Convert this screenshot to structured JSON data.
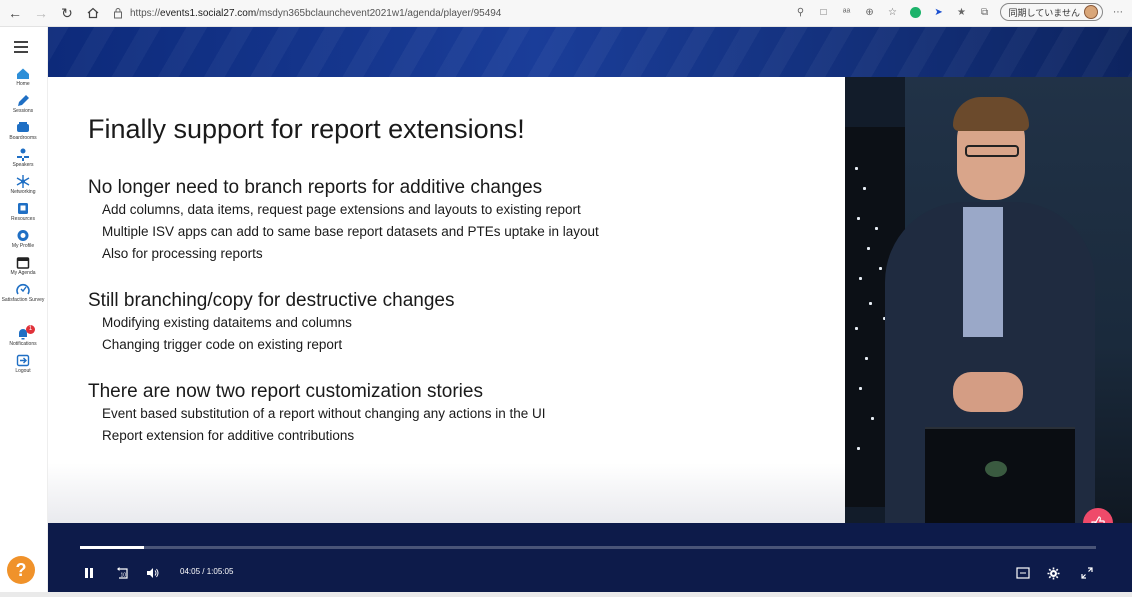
{
  "browser": {
    "url_prefix": "https://",
    "url_host": "events1.social27.com",
    "url_path": "/msdyn365bclaunchevent2021w1/agenda/player/95494",
    "profile_label": "同期していません"
  },
  "sidebar": {
    "items": [
      {
        "label": "Home",
        "icon": "home-icon"
      },
      {
        "label": "Sessions",
        "icon": "pencil-icon"
      },
      {
        "label": "Boardrooms",
        "icon": "boardroom-icon"
      },
      {
        "label": "Speakers",
        "icon": "speaker-icon"
      },
      {
        "label": "Networking",
        "icon": "networking-icon"
      },
      {
        "label": "Resources",
        "icon": "resources-icon"
      },
      {
        "label": "My Profile",
        "icon": "profile-icon"
      },
      {
        "label": "My Agenda",
        "icon": "calendar-icon"
      },
      {
        "label": "Satisfaction Survey",
        "icon": "survey-icon"
      },
      {
        "label": "Notifications",
        "icon": "bell-icon",
        "badge": "1"
      },
      {
        "label": "Logout",
        "icon": "logout-icon"
      }
    ],
    "help_label": "?"
  },
  "slide": {
    "title": "Finally support for report extensions!",
    "sections": [
      {
        "heading": "No longer need to branch reports for additive changes",
        "bullets": [
          "Add columns, data items, request page extensions and layouts to existing report",
          "Multiple ISV apps can add to same base report datasets and PTEs uptake in layout",
          "Also for processing reports"
        ]
      },
      {
        "heading": "Still branching/copy for destructive changes",
        "bullets": [
          "Modifying existing dataitems and columns",
          "Changing trigger code on existing report"
        ]
      },
      {
        "heading": "There are now two report customization stories",
        "bullets": [
          "Event based substitution of a report without changing any actions in the UI",
          "Report extension for additive contributions"
        ]
      }
    ]
  },
  "player": {
    "current_time": "04:05",
    "separator": "/",
    "duration": "1:05:05",
    "progress": 0.063,
    "colors": {
      "like": "#ef4a6a",
      "controls_bg": "#0d1b4a",
      "help": "#f0922a"
    }
  }
}
